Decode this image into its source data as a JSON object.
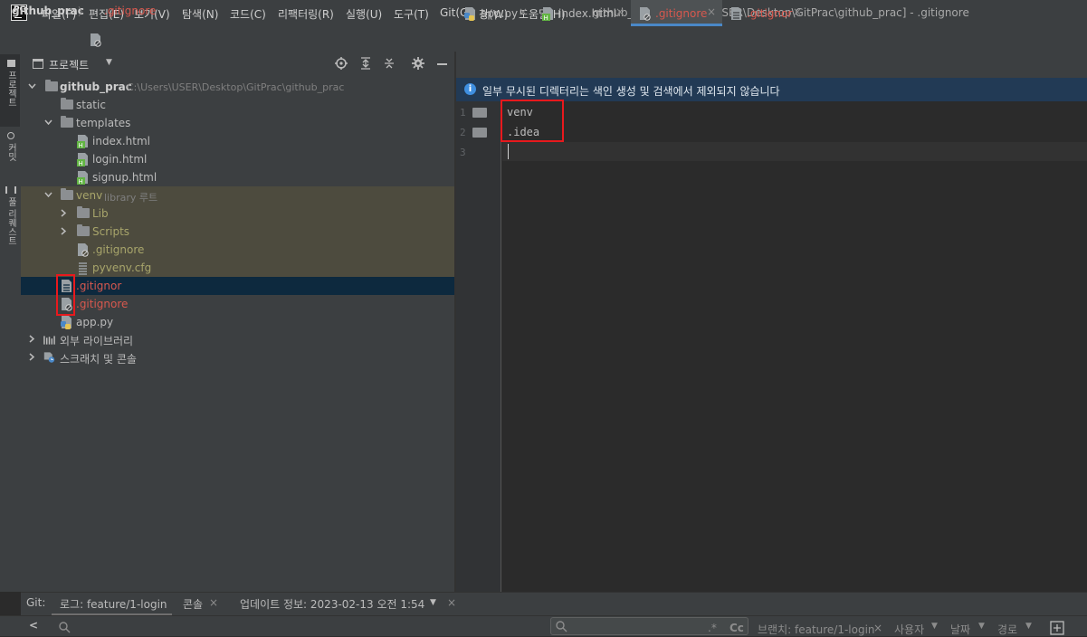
{
  "window": {
    "title": "github_prac [C:\\Users\\USER\\Desktop\\GitPrac\\github_prac] - .gitignore",
    "logo_text": "PC"
  },
  "menu": [
    "파일(F)",
    "편집(E)",
    "보기(V)",
    "탐색(N)",
    "코드(C)",
    "리팩터링(R)",
    "실행(U)",
    "도구(T)",
    "Git(G)",
    "창(W)",
    "도움말(H)"
  ],
  "navbar": {
    "project": "github_prac",
    "file": ".gitignore",
    "separator": "〉"
  },
  "stripe": {
    "project": "프로젝트",
    "commit": "커밋",
    "pull_requests": "풀 리퀘스트"
  },
  "project_panel": {
    "title": "프로젝트"
  },
  "tree": {
    "root": {
      "name": "github_prac",
      "path": "C:\\Users\\USER\\Desktop\\GitPrac\\github_prac"
    },
    "static": "static",
    "templates": "templates",
    "index_html": "index.html",
    "login_html": "login.html",
    "signup_html": "signup.html",
    "venv": {
      "name": "venv",
      "note": "library 루트"
    },
    "lib": "Lib",
    "scripts": "Scripts",
    "venv_gitignore": ".gitignore",
    "pyvenv_cfg": "pyvenv.cfg",
    "gitignor": ".gitignor",
    "gitignore": ".gitignore",
    "app_py": "app.py",
    "external_libs": "외부 라이브러리",
    "scratches": "스크래치 및 콘솔"
  },
  "tabs": [
    {
      "label": "app.py",
      "close": "×"
    },
    {
      "label": "index.html",
      "close": "×"
    },
    {
      "label": ".gitignore",
      "close": "×"
    },
    {
      "label": ".gitignor",
      "close": "×"
    }
  ],
  "infobar": {
    "icon": "i",
    "text": "일부 무시된 디렉터리는 색인 생성 및 검색에서 제외되지 않습니다"
  },
  "editor": {
    "line_numbers": [
      "1",
      "2",
      "3"
    ],
    "lines": [
      "venv",
      ".idea",
      ""
    ]
  },
  "bottom": {
    "git_label": "Git:",
    "log_tab": "로그: feature/1-login",
    "console_tab": "콘솔",
    "update_tab": "업데이트 정보: 2023-02-13 오전 1:54",
    "close": "×",
    "dropdown": "▼",
    "back": "<",
    "search_regex": ".*",
    "search_case": "Cc",
    "filter_branch": "브랜치: feature/1-login",
    "filter_user": "사용자",
    "filter_date": "날짜",
    "filter_path": "경로"
  },
  "colors": {
    "accent_blue": "#4a88c7",
    "ignored_red": "#d7584e",
    "venv_olive": "#a8a56b",
    "highlight_box": "#e8191d"
  }
}
